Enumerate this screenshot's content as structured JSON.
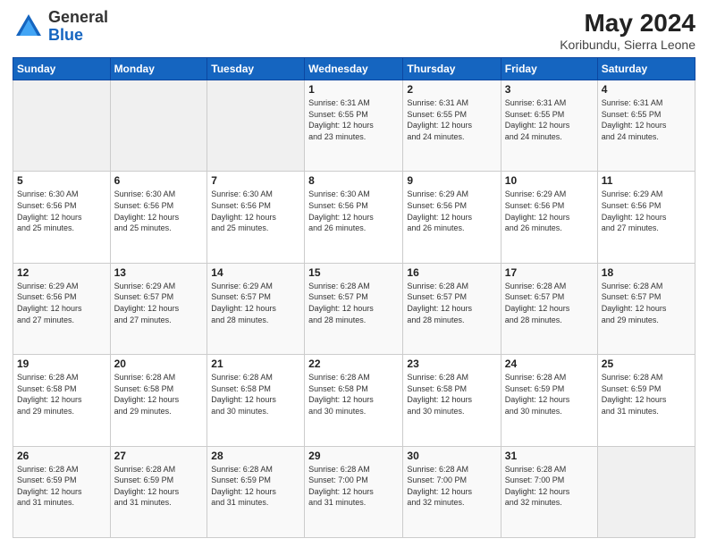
{
  "header": {
    "logo_general": "General",
    "logo_blue": "Blue",
    "month_year": "May 2024",
    "location": "Koribundu, Sierra Leone"
  },
  "days_of_week": [
    "Sunday",
    "Monday",
    "Tuesday",
    "Wednesday",
    "Thursday",
    "Friday",
    "Saturday"
  ],
  "weeks": [
    [
      {
        "day": "",
        "info": ""
      },
      {
        "day": "",
        "info": ""
      },
      {
        "day": "",
        "info": ""
      },
      {
        "day": "1",
        "info": "Sunrise: 6:31 AM\nSunset: 6:55 PM\nDaylight: 12 hours\nand 23 minutes."
      },
      {
        "day": "2",
        "info": "Sunrise: 6:31 AM\nSunset: 6:55 PM\nDaylight: 12 hours\nand 24 minutes."
      },
      {
        "day": "3",
        "info": "Sunrise: 6:31 AM\nSunset: 6:55 PM\nDaylight: 12 hours\nand 24 minutes."
      },
      {
        "day": "4",
        "info": "Sunrise: 6:31 AM\nSunset: 6:55 PM\nDaylight: 12 hours\nand 24 minutes."
      }
    ],
    [
      {
        "day": "5",
        "info": "Sunrise: 6:30 AM\nSunset: 6:56 PM\nDaylight: 12 hours\nand 25 minutes."
      },
      {
        "day": "6",
        "info": "Sunrise: 6:30 AM\nSunset: 6:56 PM\nDaylight: 12 hours\nand 25 minutes."
      },
      {
        "day": "7",
        "info": "Sunrise: 6:30 AM\nSunset: 6:56 PM\nDaylight: 12 hours\nand 25 minutes."
      },
      {
        "day": "8",
        "info": "Sunrise: 6:30 AM\nSunset: 6:56 PM\nDaylight: 12 hours\nand 26 minutes."
      },
      {
        "day": "9",
        "info": "Sunrise: 6:29 AM\nSunset: 6:56 PM\nDaylight: 12 hours\nand 26 minutes."
      },
      {
        "day": "10",
        "info": "Sunrise: 6:29 AM\nSunset: 6:56 PM\nDaylight: 12 hours\nand 26 minutes."
      },
      {
        "day": "11",
        "info": "Sunrise: 6:29 AM\nSunset: 6:56 PM\nDaylight: 12 hours\nand 27 minutes."
      }
    ],
    [
      {
        "day": "12",
        "info": "Sunrise: 6:29 AM\nSunset: 6:56 PM\nDaylight: 12 hours\nand 27 minutes."
      },
      {
        "day": "13",
        "info": "Sunrise: 6:29 AM\nSunset: 6:57 PM\nDaylight: 12 hours\nand 27 minutes."
      },
      {
        "day": "14",
        "info": "Sunrise: 6:29 AM\nSunset: 6:57 PM\nDaylight: 12 hours\nand 28 minutes."
      },
      {
        "day": "15",
        "info": "Sunrise: 6:28 AM\nSunset: 6:57 PM\nDaylight: 12 hours\nand 28 minutes."
      },
      {
        "day": "16",
        "info": "Sunrise: 6:28 AM\nSunset: 6:57 PM\nDaylight: 12 hours\nand 28 minutes."
      },
      {
        "day": "17",
        "info": "Sunrise: 6:28 AM\nSunset: 6:57 PM\nDaylight: 12 hours\nand 28 minutes."
      },
      {
        "day": "18",
        "info": "Sunrise: 6:28 AM\nSunset: 6:57 PM\nDaylight: 12 hours\nand 29 minutes."
      }
    ],
    [
      {
        "day": "19",
        "info": "Sunrise: 6:28 AM\nSunset: 6:58 PM\nDaylight: 12 hours\nand 29 minutes."
      },
      {
        "day": "20",
        "info": "Sunrise: 6:28 AM\nSunset: 6:58 PM\nDaylight: 12 hours\nand 29 minutes."
      },
      {
        "day": "21",
        "info": "Sunrise: 6:28 AM\nSunset: 6:58 PM\nDaylight: 12 hours\nand 30 minutes."
      },
      {
        "day": "22",
        "info": "Sunrise: 6:28 AM\nSunset: 6:58 PM\nDaylight: 12 hours\nand 30 minutes."
      },
      {
        "day": "23",
        "info": "Sunrise: 6:28 AM\nSunset: 6:58 PM\nDaylight: 12 hours\nand 30 minutes."
      },
      {
        "day": "24",
        "info": "Sunrise: 6:28 AM\nSunset: 6:59 PM\nDaylight: 12 hours\nand 30 minutes."
      },
      {
        "day": "25",
        "info": "Sunrise: 6:28 AM\nSunset: 6:59 PM\nDaylight: 12 hours\nand 31 minutes."
      }
    ],
    [
      {
        "day": "26",
        "info": "Sunrise: 6:28 AM\nSunset: 6:59 PM\nDaylight: 12 hours\nand 31 minutes."
      },
      {
        "day": "27",
        "info": "Sunrise: 6:28 AM\nSunset: 6:59 PM\nDaylight: 12 hours\nand 31 minutes."
      },
      {
        "day": "28",
        "info": "Sunrise: 6:28 AM\nSunset: 6:59 PM\nDaylight: 12 hours\nand 31 minutes."
      },
      {
        "day": "29",
        "info": "Sunrise: 6:28 AM\nSunset: 7:00 PM\nDaylight: 12 hours\nand 31 minutes."
      },
      {
        "day": "30",
        "info": "Sunrise: 6:28 AM\nSunset: 7:00 PM\nDaylight: 12 hours\nand 32 minutes."
      },
      {
        "day": "31",
        "info": "Sunrise: 6:28 AM\nSunset: 7:00 PM\nDaylight: 12 hours\nand 32 minutes."
      },
      {
        "day": "",
        "info": ""
      }
    ]
  ]
}
